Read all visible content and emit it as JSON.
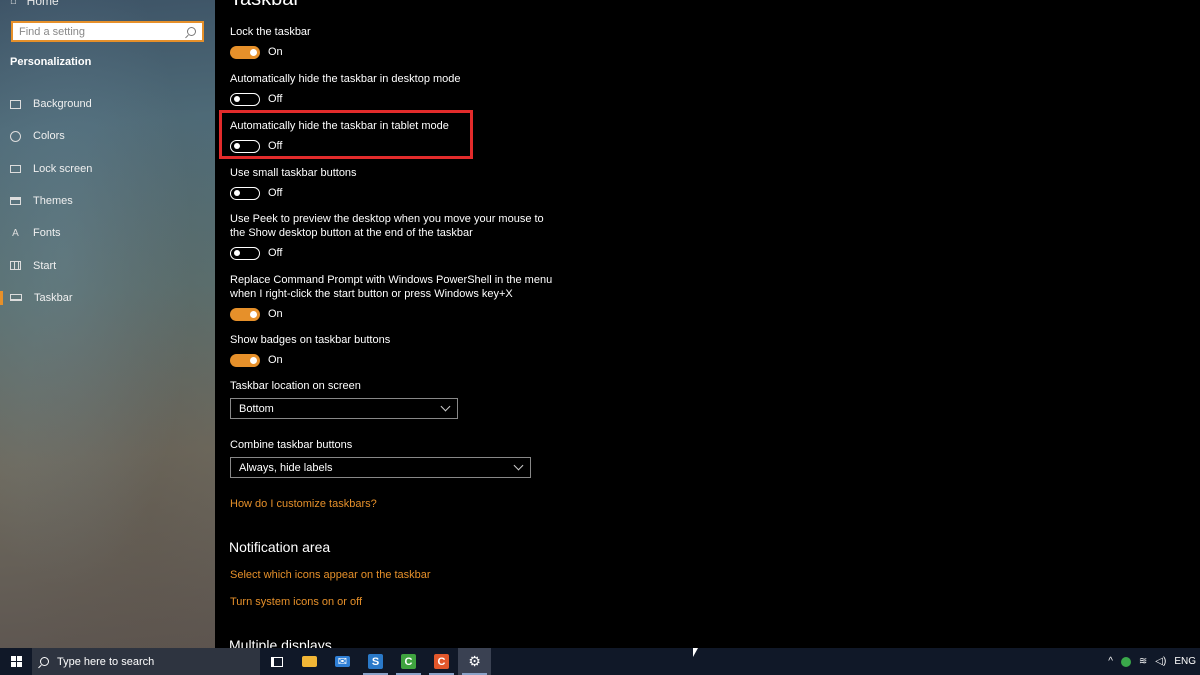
{
  "sidebar": {
    "home_label": "Home",
    "search_placeholder": "Find a setting",
    "section": "Personalization",
    "items": [
      {
        "label": "Background",
        "icon": "image-icon"
      },
      {
        "label": "Colors",
        "icon": "palette-icon"
      },
      {
        "label": "Lock screen",
        "icon": "lock-screen-icon"
      },
      {
        "label": "Themes",
        "icon": "themes-icon"
      },
      {
        "label": "Fonts",
        "icon": "fonts-icon"
      },
      {
        "label": "Start",
        "icon": "start-icon"
      },
      {
        "label": "Taskbar",
        "icon": "taskbar-icon",
        "active": true
      }
    ]
  },
  "main": {
    "title": "Taskbar",
    "settings": [
      {
        "label": "Lock the taskbar",
        "state": "On"
      },
      {
        "label": "Automatically hide the taskbar in desktop mode",
        "state": "Off"
      },
      {
        "label": "Automatically hide the taskbar in tablet mode",
        "state": "Off"
      },
      {
        "label": "Use small taskbar buttons",
        "state": "Off"
      },
      {
        "label_line1": "Use Peek to preview the desktop when you move your mouse to",
        "label_line2": "the Show desktop button at the end of the taskbar",
        "state": "Off"
      },
      {
        "label_line1": "Replace Command Prompt with Windows PowerShell in the menu",
        "label_line2": "when I right-click the start button or press Windows key+X",
        "state": "On"
      },
      {
        "label": "Show badges on taskbar buttons",
        "state": "On"
      }
    ],
    "location": {
      "label": "Taskbar location on screen",
      "value": "Bottom"
    },
    "combine": {
      "label": "Combine taskbar buttons",
      "value": "Always, hide labels"
    },
    "help_link": "How do I customize taskbars?",
    "notification_area": {
      "heading": "Notification area",
      "link1": "Select which icons appear on the taskbar",
      "link2": "Turn system icons on or off"
    },
    "multiple_displays": "Multiple displays"
  },
  "taskbar": {
    "search_text": "Type here to search",
    "apps": [
      {
        "icon": "task-view-icon"
      },
      {
        "icon": "file-explorer-icon",
        "color": "#f2b636"
      },
      {
        "icon": "mail-icon",
        "color": "#2f7fd6"
      },
      {
        "icon": "snagit-icon",
        "color": "#2a79c9",
        "glyph": "S"
      },
      {
        "icon": "camtasia-green-icon",
        "color": "#3fa33f",
        "glyph": "C"
      },
      {
        "icon": "camtasia-orange-icon",
        "color": "#e2572b",
        "glyph": "C"
      },
      {
        "icon": "settings-icon",
        "glyph": "⚙"
      }
    ],
    "tray_lang": "ENG"
  },
  "colors": {
    "accent": "#e6902a",
    "highlight": "#e32b2b"
  }
}
